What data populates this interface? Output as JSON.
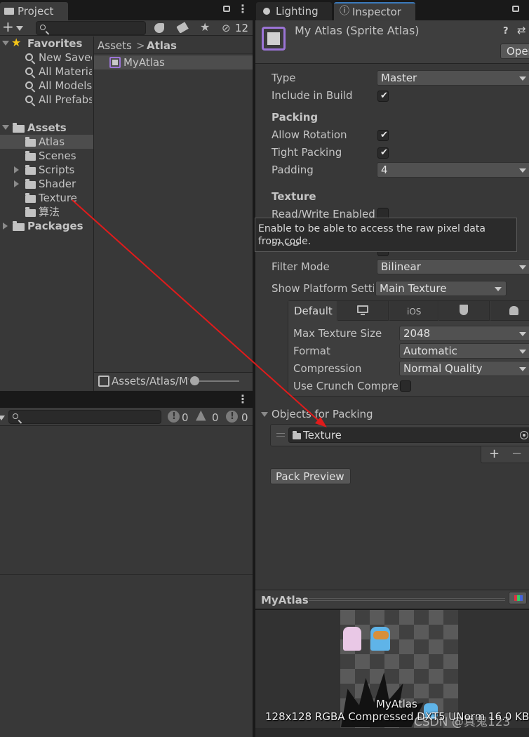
{
  "project_panel": {
    "tab_label": "Project",
    "hidden_count": "12",
    "favorites_label": "Favorites",
    "favorites": [
      "New Saved",
      "All Materials",
      "All Models",
      "All Prefabs"
    ],
    "assets_label": "Assets",
    "asset_folders": [
      "Atlas",
      "Scenes",
      "Scripts",
      "Shader",
      "Texture",
      "算法"
    ],
    "packages_label": "Packages",
    "breadcrumb": [
      "Assets",
      "Atlas"
    ],
    "breadcrumb_sep": ">",
    "files": [
      "MyAtlas"
    ],
    "footer_path": "Assets/Atlas/MyAtlas"
  },
  "console_panel": {
    "info_count": "0",
    "warning_count": "0",
    "error_count": "0"
  },
  "inspector": {
    "lighting_tab": "Lighting",
    "inspector_tab": "Inspector",
    "header_title": "My Atlas (Sprite Atlas)",
    "open_button": "Open",
    "type_label": "Type",
    "type_value": "Master",
    "include_in_build_label": "Include in Build",
    "include_in_build": true,
    "packing_header": "Packing",
    "allow_rotation_label": "Allow Rotation",
    "tight_packing_label": "Tight Packing",
    "padding_label": "Padding",
    "padding_value": "4",
    "texture_header": "Texture",
    "read_write_label": "Read/Write Enabled",
    "tooltip_text_line1": "Enable to be able to access the raw pixel data",
    "tooltip_text_line2": "from code.",
    "srgb_label": "sRGB",
    "filter_mode_label": "Filter Mode",
    "filter_mode_value": "Bilinear",
    "show_platform_label": "Show Platform Settings",
    "show_platform_value": "Main Texture",
    "platform_default_tab": "Default",
    "platform_ios_tab": "iOS",
    "max_texture_size_label": "Max Texture Size",
    "max_texture_size_value": "2048",
    "format_label": "Format",
    "format_value": "Automatic",
    "compression_label": "Compression",
    "compression_value": "Normal Quality",
    "use_crunch_label": "Use Crunch Compression",
    "objects_for_packing_label": "Objects for Packing",
    "packing_objects": [
      "Texture"
    ],
    "plus_label": "+",
    "minus_label": "−",
    "pack_preview_button": "Pack Preview"
  },
  "preview": {
    "title": "MyAtlas",
    "atlas_name": "MyAtlas",
    "info": "128x128 RGBA Compressed DXT5 UNorm  16.0 KB"
  },
  "watermark": "CSDN @真鬼123",
  "colors": {
    "accent_blue": "#2c5d87",
    "selection": "#4d4d4d",
    "arrow_red": "#e01b1b",
    "atlas_icon_purple": "#9b74d6"
  }
}
